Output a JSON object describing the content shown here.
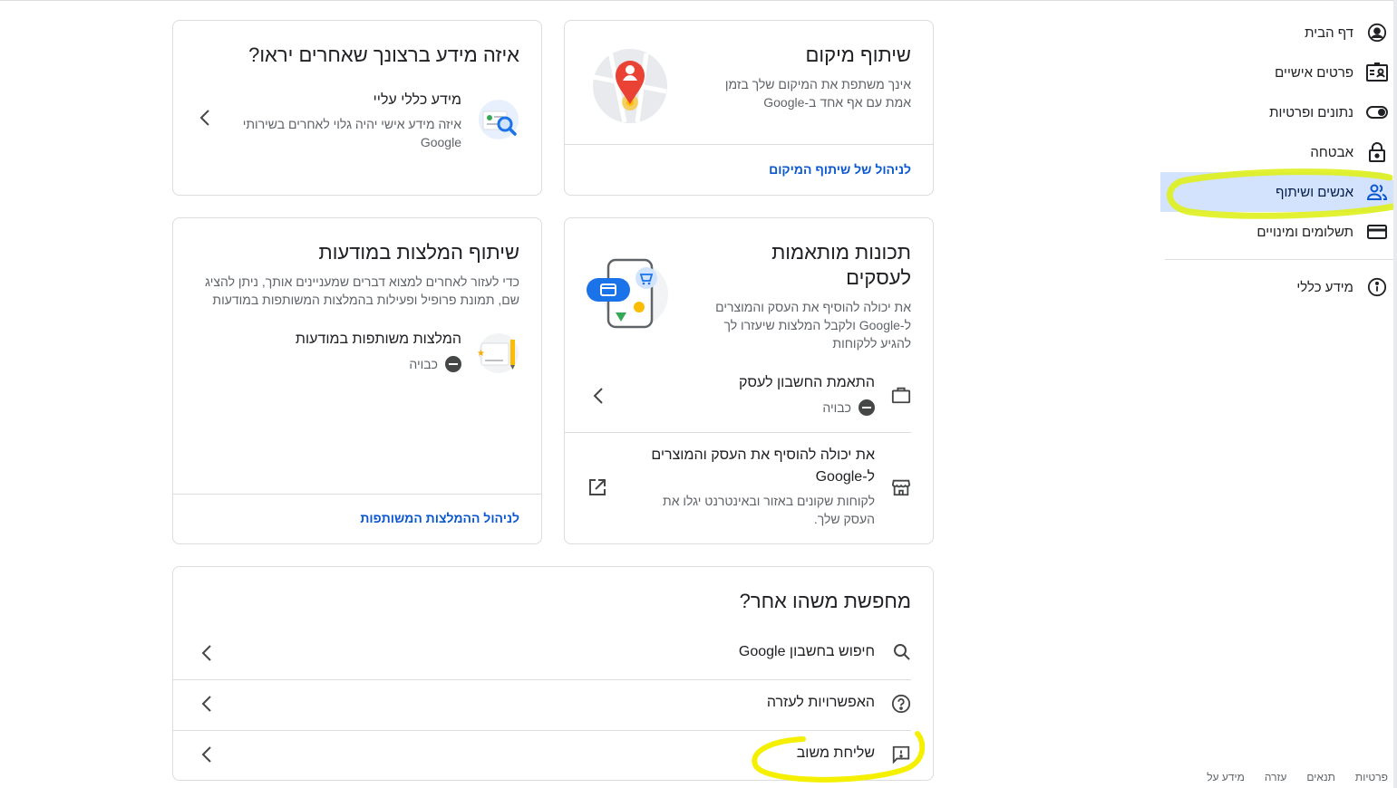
{
  "sidebar": {
    "items": [
      {
        "label": "דף הבית",
        "icon": "account-circle-icon"
      },
      {
        "label": "פרטים אישיים",
        "icon": "id-card-icon"
      },
      {
        "label": "נתונים ופרטיות",
        "icon": "toggle-icon"
      },
      {
        "label": "אבטחה",
        "icon": "lock-icon"
      },
      {
        "label": "אנשים ושיתוף",
        "icon": "people-icon",
        "active": true
      },
      {
        "label": "תשלומים ומינויים",
        "icon": "credit-card-icon"
      },
      {
        "label": "מידע כללי",
        "icon": "info-icon"
      }
    ]
  },
  "footer": {
    "privacy": "פרטיות",
    "terms": "תנאים",
    "help": "עזרה",
    "about": "מידע על"
  },
  "location_card": {
    "title": "שיתוף מיקום",
    "desc": "אינך משתפת את המיקום שלך בזמן אמת עם אף אחד ב-Google",
    "link": "לניהול של שיתוף המיקום"
  },
  "about_card": {
    "title": "איזה מידע ברצונך שאחרים יראו?",
    "row_title": "מידע כללי עליי",
    "row_desc": "איזה מידע אישי יהיה גלוי לאחרים בשירותי Google"
  },
  "business_card": {
    "title": "תכונות מותאמות לעסקים",
    "desc": "את יכולה להוסיף את העסק והמוצרים ל-Google ולקבל המלצות שיעזרו לך להגיע ללקוחות",
    "row1_title": "התאמת החשבון לעסק",
    "row1_status": "כבויה",
    "row2_title": "את יכולה להוסיף את העסק והמוצרים ל-Google",
    "row2_desc": "לקוחות שקונים באזור ובאינטרנט יגלו את העסק שלך."
  },
  "endorsements_card": {
    "title": "שיתוף המלצות במודעות",
    "desc": "כדי לעזור לאחרים למצוא דברים שמעניינים אותך, ניתן להציג שם, תמונת פרופיל ופעילות בהמלצות המשותפות במודעות",
    "row_title": "המלצות משותפות במודעות",
    "row_status": "כבויה",
    "link": "לניהול ההמלצות המשותפות"
  },
  "more_card": {
    "title": "מחפשת משהו אחר?",
    "items": [
      {
        "label": "חיפוש בחשבון Google",
        "icon": "search-icon"
      },
      {
        "label": "האפשרויות לעזרה",
        "icon": "help-icon"
      },
      {
        "label": "שליחת משוב",
        "icon": "feedback-icon"
      }
    ]
  },
  "colors": {
    "accent": "#0b57d0",
    "active_bg": "#d3e3fd",
    "highlight": "#f5f000"
  }
}
